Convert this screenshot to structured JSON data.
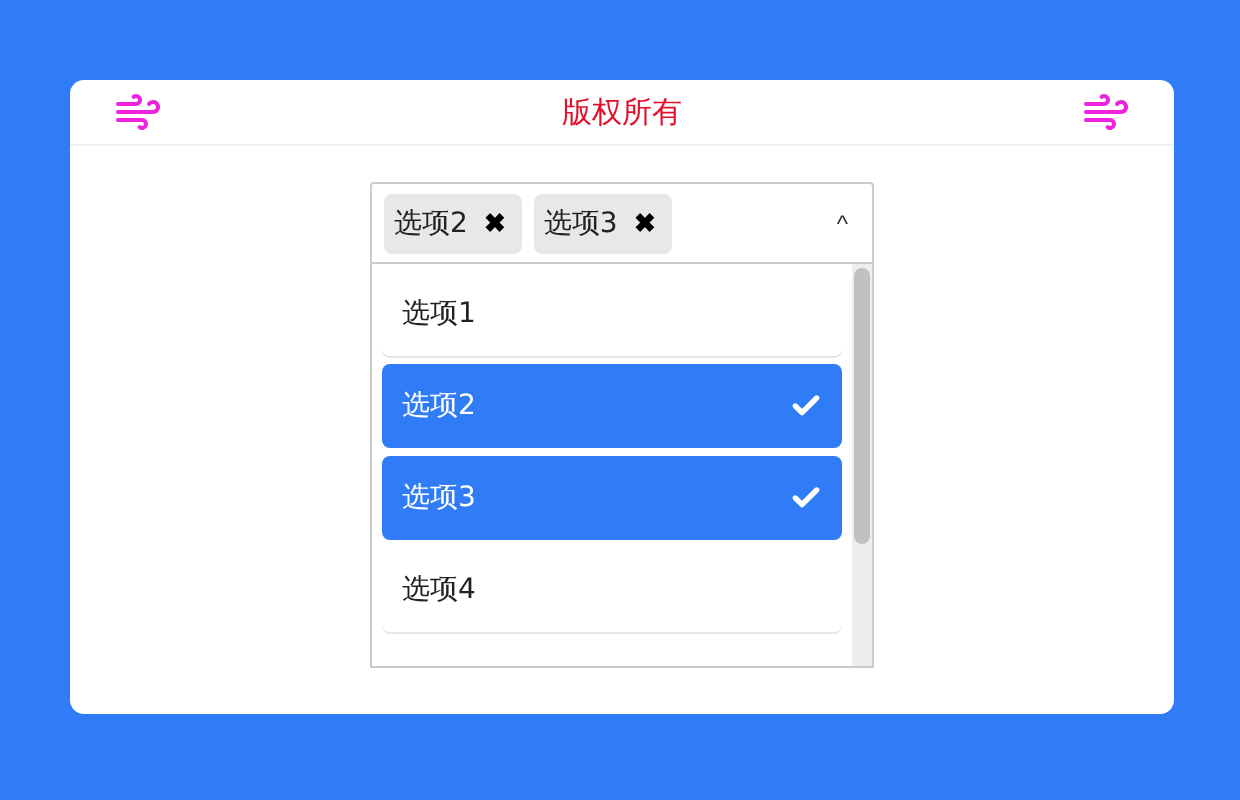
{
  "header": {
    "title": "版权所有"
  },
  "select": {
    "tags": [
      {
        "label": "选项2",
        "remove": "✖"
      },
      {
        "label": "选项3",
        "remove": "✖"
      }
    ],
    "caret": "^",
    "expanded": true
  },
  "options": [
    {
      "label": "选项1",
      "selected": false
    },
    {
      "label": "选项2",
      "selected": true
    },
    {
      "label": "选项3",
      "selected": true
    },
    {
      "label": "选项4",
      "selected": false
    }
  ]
}
